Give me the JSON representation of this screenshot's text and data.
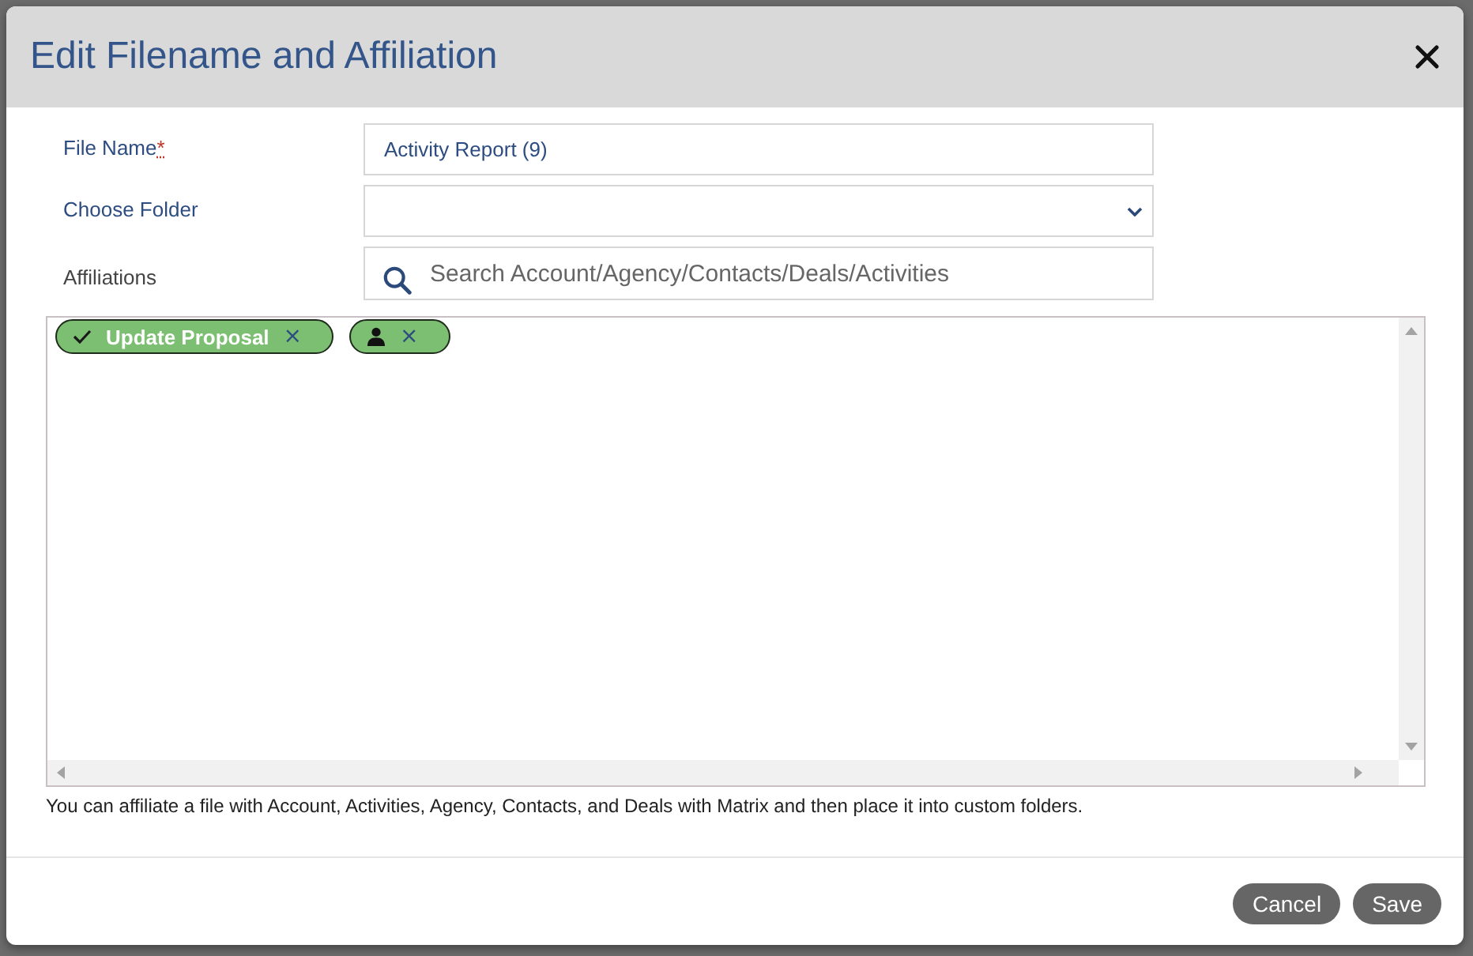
{
  "dialog": {
    "title": "Edit Filename and Affiliation"
  },
  "fields": [
    {
      "kind": "text",
      "label": "File Name",
      "required_mark": "*",
      "value": "Activity Report (9)"
    },
    {
      "kind": "select",
      "label": "Choose Folder"
    },
    {
      "kind": "search",
      "label": "Affiliations",
      "placeholder": "Search Account/Agency/Contacts/Deals/Activities"
    }
  ],
  "tags": [
    {
      "kind": "activity",
      "label": "Update Proposal",
      "remove": "×"
    },
    {
      "kind": "contact",
      "remove": "×"
    }
  ],
  "help_text": "You can affiliate a file with Account, Activities, Agency, Contacts, and Deals with Matrix and then place it into custom folders.",
  "buttons": [
    {
      "label": "Cancel"
    },
    {
      "label": "Save"
    }
  ]
}
